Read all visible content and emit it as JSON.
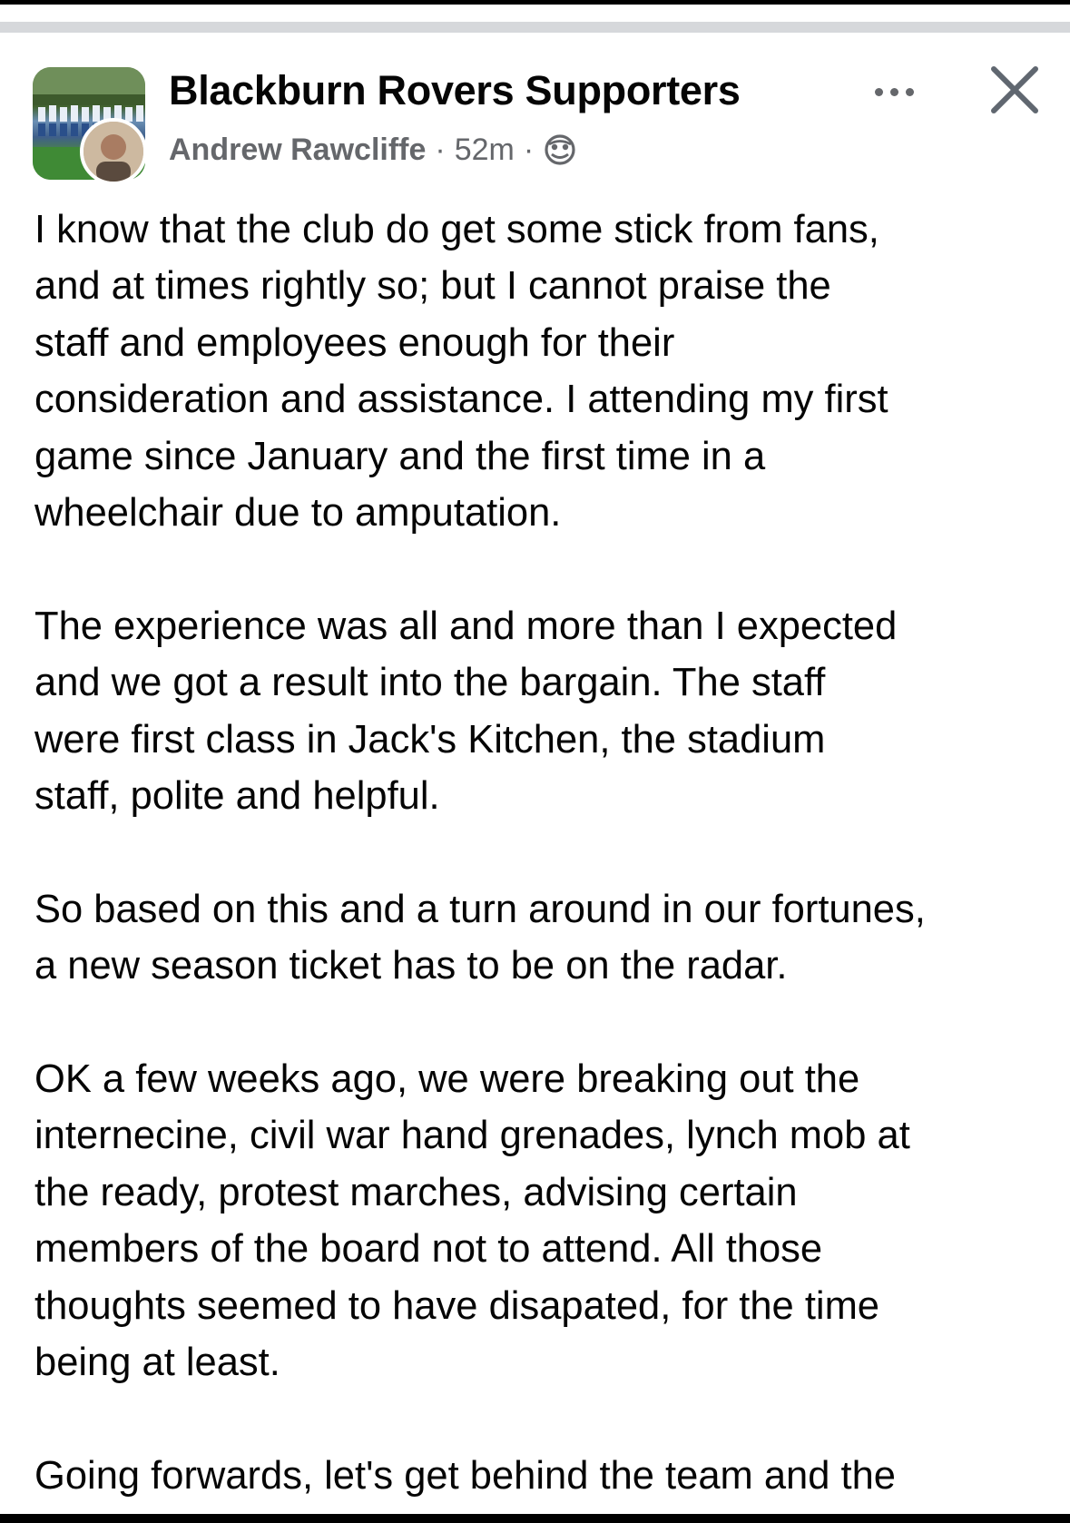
{
  "post": {
    "group_name": "Blackburn Rovers Supporters",
    "author": "Andrew Rawcliffe",
    "separator": "·",
    "time": "52m",
    "privacy_icon": "globe-icon",
    "more_icon": "more-options-icon",
    "close_icon": "close-icon",
    "paragraphs": [
      "I know that the club do get some stick from fans,\nand at times rightly so; but I cannot praise the\nstaff and employees enough for their\nconsideration and assistance. I attending my first\ngame since January and the first time in a\nwheelchair due to amputation.",
      "The experience was all and more than I expected\nand we got a result into the bargain. The staff\nwere first class in Jack's Kitchen, the stadium\nstaff, polite and helpful.",
      "So based on this and a turn around in our fortunes,\na new season ticket has to be on the radar.",
      "OK a few weeks ago, we were breaking out the\ninternecine, civil war hand grenades, lynch mob at\nthe ready, protest marches, advising certain\nmembers of the board not to attend. All those\nthoughts seemed to have disapated, for the time\nbeing at least.",
      "Going forwards, let's get behind the team and the"
    ]
  },
  "colors": {
    "primary_text": "#050505",
    "secondary_text": "#65676b",
    "divider": "#d6d8db"
  }
}
